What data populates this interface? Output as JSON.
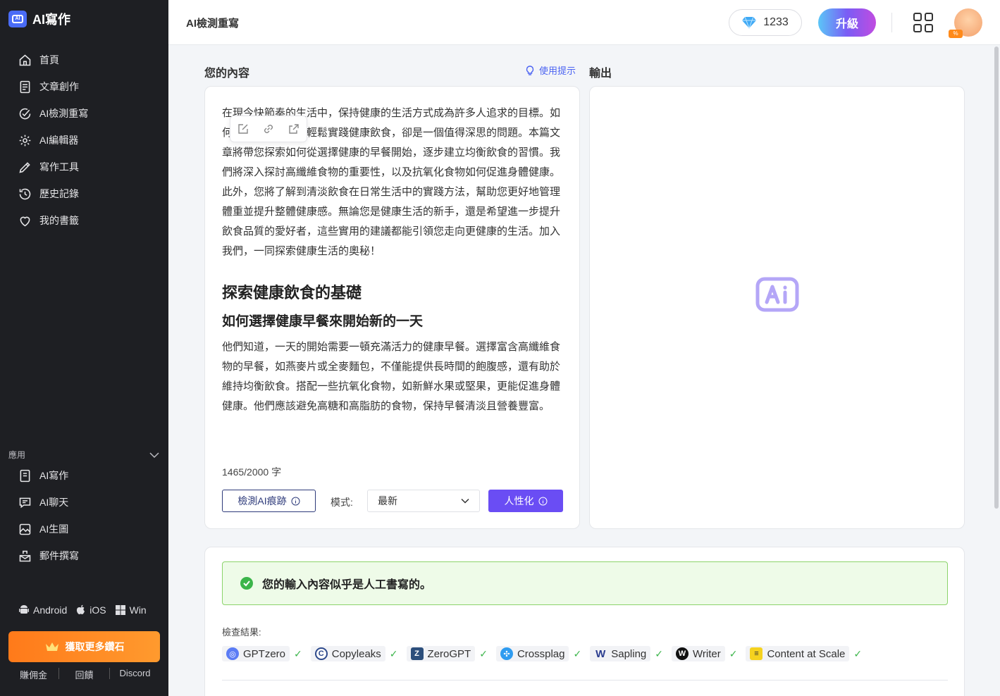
{
  "app": {
    "name": "AI寫作"
  },
  "sidebar": {
    "items": [
      {
        "label": "首頁",
        "icon": "home-icon"
      },
      {
        "label": "文章創作",
        "icon": "document-icon"
      },
      {
        "label": "AI檢測重寫",
        "icon": "check-circle-icon"
      },
      {
        "label": "AI編輯器",
        "icon": "gear-icon"
      },
      {
        "label": "寫作工具",
        "icon": "pen-icon"
      },
      {
        "label": "歷史記錄",
        "icon": "history-icon"
      },
      {
        "label": "我的書籤",
        "icon": "heart-icon"
      }
    ],
    "apps_header": "應用",
    "apps": [
      {
        "label": "AI寫作",
        "icon": "write-app-icon"
      },
      {
        "label": "AI聊天",
        "icon": "chat-icon"
      },
      {
        "label": "AI生圖",
        "icon": "image-icon"
      },
      {
        "label": "郵件撰寫",
        "icon": "mail-icon"
      }
    ],
    "platforms": [
      "Android",
      "iOS",
      "Win"
    ],
    "cta": "獲取更多鑽石",
    "footer_links": [
      "賺佣金",
      "回饋",
      "Discord"
    ]
  },
  "topbar": {
    "title": "AI檢測重寫",
    "gems": "1233",
    "upgrade": "升級",
    "avatar_badge": "%"
  },
  "input": {
    "label": "您的內容",
    "hint": "使用提示",
    "paragraph1": "在現今快節奏的生活中，保持健康的生活方式成為許多人追求的目標。如何在忙碌的日常中輕鬆實踐健康飲食，卻是一個值得深思的問題。本篇文章將帶您探索如何從選擇健康的早餐開始，逐步建立均衡飲食的習慣。我們將深入探討高纖維食物的重要性，以及抗氧化食物如何促進身體健康。此外，您將了解到清淡飲食在日常生活中的實踐方法，幫助您更好地管理體重並提升整體健康感。無論您是健康生活的新手，還是希望進一步提升飲食品質的愛好者，這些實用的建議都能引領您走向更健康的生活。加入我們，一同探索健康生活的奧秘！",
    "heading2": "探索健康飲食的基礎",
    "heading3": "如何選擇健康早餐來開始新的一天",
    "paragraph2": "他們知道，一天的開始需要一頓充滿活力的健康早餐。選擇富含高纖維食物的早餐，如燕麥片或全麥麵包，不僅能提供長時間的飽腹感，還有助於維持均衡飲食。搭配一些抗氧化食物，如新鮮水果或堅果，更能促進身體健康。他們應該避免高糖和高脂肪的食物，保持早餐清淡且營養豐富。",
    "word_count": "1465/2000 字",
    "detect_button": "檢測AI痕跡",
    "mode_label": "模式:",
    "mode_value": "最新",
    "humanize_button": "人性化"
  },
  "output": {
    "label": "輸出"
  },
  "result": {
    "message": "您的輸入內容似乎是人工書寫的。",
    "check_label": "檢查結果:",
    "detectors": [
      "GPTzero",
      "Copyleaks",
      "ZeroGPT",
      "Crossplag",
      "Sapling",
      "Writer",
      "Content at Scale"
    ]
  },
  "colors": {
    "accent": "#6a4df4",
    "link": "#4b63f2",
    "success": "#3bb54a",
    "cta": "#ff8a1a",
    "sidebar_bg": "#1e1f23"
  }
}
